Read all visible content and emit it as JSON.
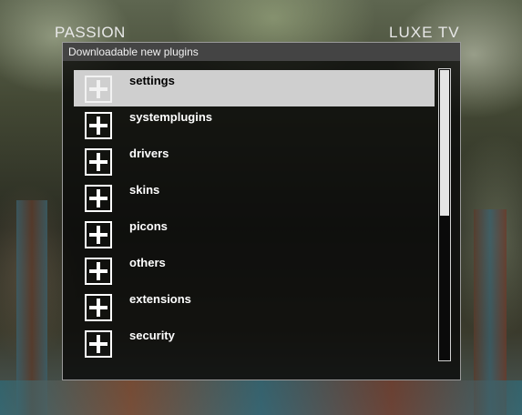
{
  "header": {
    "left_text": "PASSION",
    "right_text": "LUXE TV"
  },
  "window": {
    "title": "Downloadable new plugins"
  },
  "items": [
    {
      "label": "settings",
      "icon": "plus-icon",
      "selected": true
    },
    {
      "label": "systemplugins",
      "icon": "plus-icon",
      "selected": false
    },
    {
      "label": "drivers",
      "icon": "plus-icon",
      "selected": false
    },
    {
      "label": "skins",
      "icon": "plus-icon",
      "selected": false
    },
    {
      "label": "picons",
      "icon": "plus-icon",
      "selected": false
    },
    {
      "label": "others",
      "icon": "plus-icon",
      "selected": false
    },
    {
      "label": "extensions",
      "icon": "plus-icon",
      "selected": false
    },
    {
      "label": "security",
      "icon": "plus-icon",
      "selected": false
    }
  ],
  "colors": {
    "selection": "#cfcfcf",
    "window_bg": "#080808",
    "title_bar": "#444444"
  }
}
